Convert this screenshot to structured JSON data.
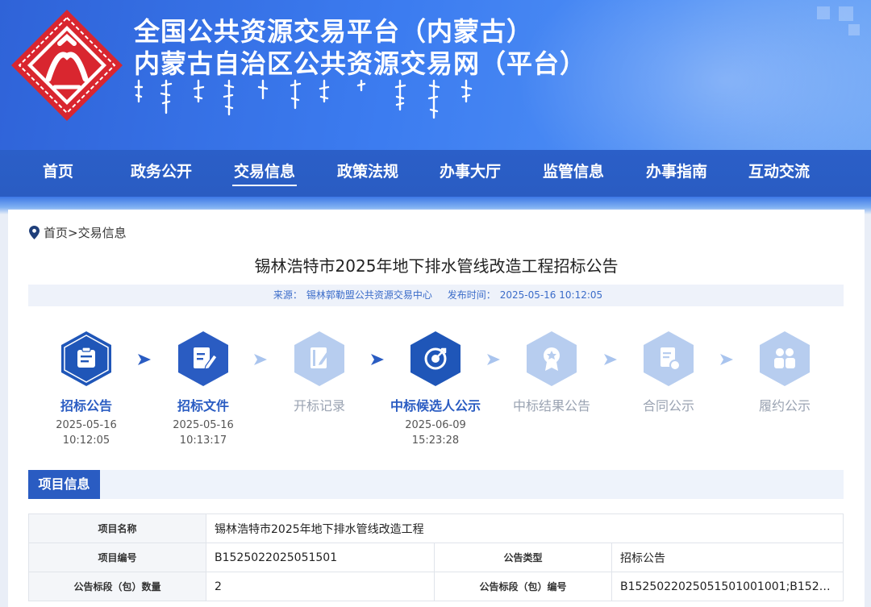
{
  "header": {
    "title_line1": "全国公共资源交易平台（内蒙古）",
    "title_line2": "内蒙古自治区公共资源交易网（平台）"
  },
  "nav": {
    "items": [
      {
        "label": "首页"
      },
      {
        "label": "政务公开"
      },
      {
        "label": "交易信息",
        "active": true
      },
      {
        "label": "政策法规"
      },
      {
        "label": "办事大厅"
      },
      {
        "label": "监管信息"
      },
      {
        "label": "办事指南"
      },
      {
        "label": "互动交流"
      }
    ]
  },
  "breadcrumb": {
    "home": "首页",
    "separator": ">",
    "current": "交易信息"
  },
  "article": {
    "title": "锡林浩特市2025年地下排水管线改造工程招标公告",
    "source_label": "来源：",
    "source": "锡林郭勒盟公共资源交易中心",
    "publish_label": "发布时间：",
    "publish_time": "2025-05-16 10:12:05"
  },
  "steps": [
    {
      "label": "招标公告",
      "date": "2025-05-16",
      "time": "10:12:05",
      "status": "done",
      "icon": "document-icon"
    },
    {
      "label": "招标文件",
      "date": "2025-05-16",
      "time": "10:13:17",
      "status": "done",
      "icon": "edit-document-icon"
    },
    {
      "label": "开标记录",
      "date": "",
      "time": "",
      "status": "todo",
      "icon": "notebook-pen-icon"
    },
    {
      "label": "中标候选人公示",
      "date": "2025-06-09",
      "time": "15:23:28",
      "status": "done",
      "icon": "target-icon"
    },
    {
      "label": "中标结果公告",
      "date": "",
      "time": "",
      "status": "todo",
      "icon": "award-badge-icon"
    },
    {
      "label": "合同公示",
      "date": "",
      "time": "",
      "status": "todo",
      "icon": "contract-icon"
    },
    {
      "label": "履约公示",
      "date": "",
      "time": "",
      "status": "todo",
      "icon": "people-icon"
    }
  ],
  "project_info": {
    "section_title": "项目信息",
    "rows": {
      "name_key": "项目名称",
      "name_value": "锡林浩特市2025年地下排水管线改造工程",
      "code_key": "项目编号",
      "code_value": "B1525022025051501",
      "type_key": "公告类型",
      "type_value": "招标公告",
      "lot_count_key": "公告标段（包）数量",
      "lot_count_value": "2",
      "lot_code_key": "公告标段（包）编号",
      "lot_code_value": "B1525022025051501001001;B152…"
    }
  },
  "colors": {
    "primary": "#2a5cc2",
    "banner": "#3c7cf0",
    "logo_red": "#d9262f",
    "step_done": "#2a5cc2",
    "step_todo": "#a9c4ee"
  }
}
